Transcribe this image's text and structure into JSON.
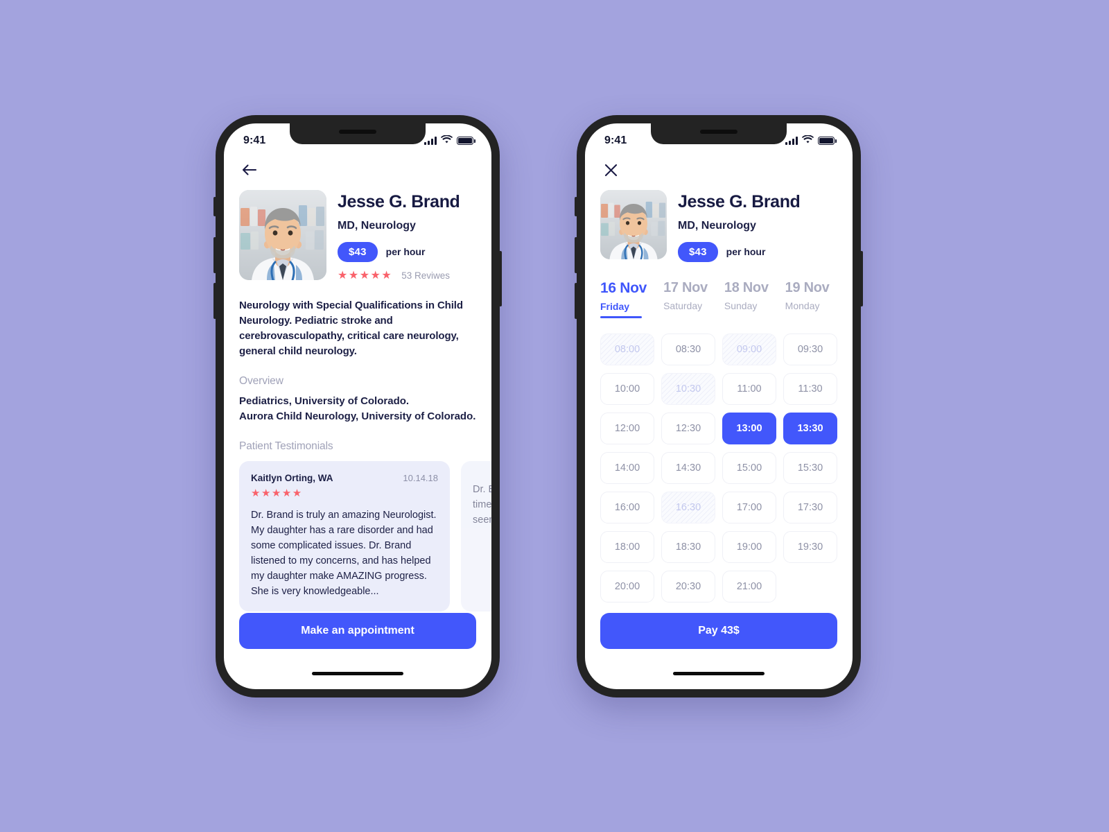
{
  "theme": {
    "background": "#A3A3DE",
    "accent": "#4257FB",
    "star_color": "#F9626B",
    "text_dark": "#1C1F45",
    "text_muted": "#A0A2B8",
    "card_bg": "#EBEDFA"
  },
  "doctor": {
    "name": "Jesse G. Brand",
    "specialty": "MD, Neurology",
    "price": "$43",
    "price_unit": "per hour",
    "stars": "★★★★★",
    "reviews": "53 Reviwes",
    "photo_alt": "doctor-portrait"
  },
  "screen_left": {
    "status": {
      "time": "9:41",
      "signal": "signal-icon",
      "wifi": "wifi-icon",
      "battery": "battery-icon"
    },
    "nav": {
      "back_label": "back-arrow"
    },
    "bio": "Neurology with Special Qualifications in Child Neurology.  Pediatric stroke and cerebrovasculopathy, critical care neurology, general child neurology.",
    "overview_heading": "Overview",
    "overview_lines": [
      "Pediatrics, University of Colorado.",
      "Aurora Child Neurology, University of Colorado."
    ],
    "testimonials_heading": "Patient Testimonials",
    "testimonials": [
      {
        "author": "Kaitlyn Orting, WA",
        "date": "10.14.18",
        "stars": "★★★★★",
        "body": "Dr. Brand is truly an amazing Neurologist. My daughter has a rare disorder and had some complicated issues. Dr. Brand listened to my concerns, and has helped my daughter make AMAZING progress. She is very knowledgeable..."
      },
      {
        "author": "",
        "date": "",
        "stars": "",
        "body": "Dr. Brand is very attentive and takes the time to answer questions. Our family has seen him for several years and always..."
      }
    ],
    "cta_label": "Make an appointment"
  },
  "screen_right": {
    "status": {
      "time": "9:41",
      "signal": "signal-icon",
      "wifi": "wifi-icon",
      "battery": "battery-icon"
    },
    "nav": {
      "close_label": "close-icon"
    },
    "dates": [
      {
        "day_number": "16 Nov",
        "weekday": "Friday",
        "active": true
      },
      {
        "day_number": "17 Nov",
        "weekday": "Saturday",
        "active": false
      },
      {
        "day_number": "18 Nov",
        "weekday": "Sunday",
        "active": false
      },
      {
        "day_number": "19 Nov",
        "weekday": "Monday",
        "active": false
      }
    ],
    "slots": [
      {
        "time": "08:00",
        "state": "disabled"
      },
      {
        "time": "08:30",
        "state": "available"
      },
      {
        "time": "09:00",
        "state": "disabled"
      },
      {
        "time": "09:30",
        "state": "available"
      },
      {
        "time": "10:00",
        "state": "available"
      },
      {
        "time": "10:30",
        "state": "disabled"
      },
      {
        "time": "11:00",
        "state": "available"
      },
      {
        "time": "11:30",
        "state": "available"
      },
      {
        "time": "12:00",
        "state": "available"
      },
      {
        "time": "12:30",
        "state": "available"
      },
      {
        "time": "13:00",
        "state": "selected"
      },
      {
        "time": "13:30",
        "state": "selected"
      },
      {
        "time": "14:00",
        "state": "available"
      },
      {
        "time": "14:30",
        "state": "available"
      },
      {
        "time": "15:00",
        "state": "available"
      },
      {
        "time": "15:30",
        "state": "available"
      },
      {
        "time": "16:00",
        "state": "available"
      },
      {
        "time": "16:30",
        "state": "disabled"
      },
      {
        "time": "17:00",
        "state": "available"
      },
      {
        "time": "17:30",
        "state": "available"
      },
      {
        "time": "18:00",
        "state": "available"
      },
      {
        "time": "18:30",
        "state": "available"
      },
      {
        "time": "19:00",
        "state": "available"
      },
      {
        "time": "19:30",
        "state": "available"
      },
      {
        "time": "20:00",
        "state": "available"
      },
      {
        "time": "20:30",
        "state": "available"
      },
      {
        "time": "21:00",
        "state": "available"
      }
    ],
    "cta_label": "Pay 43$"
  }
}
